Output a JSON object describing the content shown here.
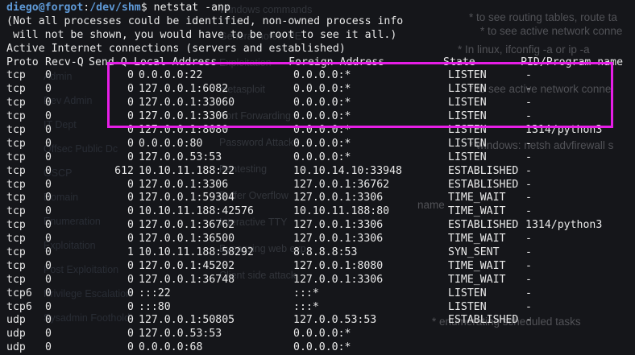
{
  "prompt": {
    "user_host": "diego@forgot",
    "sep": ":",
    "path": "/dev/shm",
    "symbol": "$",
    "command": " netstat -anp"
  },
  "notice": [
    "(Not all processes could be identified, non-owned process info",
    " will not be shown, you would have to be root to see it all.)",
    "Active Internet connections (servers and established)"
  ],
  "headers": [
    "Proto",
    "Recv-Q",
    "Send-Q",
    "Local Address",
    "Foreign Address",
    "State",
    "PID/Program name"
  ],
  "rows": [
    [
      "tcp",
      "0",
      "0",
      "0.0.0.0:22",
      "0.0.0.0:*",
      "LISTEN",
      "-"
    ],
    [
      "tcp",
      "0",
      "0",
      "127.0.0.1:6082",
      "0.0.0.0:*",
      "LISTEN",
      "-"
    ],
    [
      "tcp",
      "0",
      "0",
      "127.0.0.1:33060",
      "0.0.0.0:*",
      "LISTEN",
      "-"
    ],
    [
      "tcp",
      "0",
      "0",
      "127.0.0.1:3306",
      "0.0.0.0:*",
      "LISTEN",
      "-"
    ],
    [
      "tcp",
      "0",
      "0",
      "127.0.0.1:8080",
      "0.0.0.0:*",
      "LISTEN",
      "1314/python3"
    ],
    [
      "tcp",
      "0",
      "0",
      "0.0.0.0:80",
      "0.0.0.0:*",
      "LISTEN",
      "-"
    ],
    [
      "tcp",
      "0",
      "0",
      "127.0.0.53:53",
      "0.0.0.0:*",
      "LISTEN",
      "-"
    ],
    [
      "tcp",
      "0",
      "612",
      "10.10.11.188:22",
      "10.10.14.10:33948",
      "ESTABLISHED",
      "-"
    ],
    [
      "tcp",
      "0",
      "0",
      "127.0.0.1:3306",
      "127.0.0.1:36762",
      "ESTABLISHED",
      "-"
    ],
    [
      "tcp",
      "0",
      "0",
      "127.0.0.1:59304",
      "127.0.0.1:3306",
      "TIME_WAIT",
      "-"
    ],
    [
      "tcp",
      "0",
      "0",
      "10.10.11.188:42576",
      "10.10.11.188:80",
      "TIME_WAIT",
      "-"
    ],
    [
      "tcp",
      "0",
      "0",
      "127.0.0.1:36762",
      "127.0.0.1:3306",
      "ESTABLISHED",
      "1314/python3"
    ],
    [
      "tcp",
      "0",
      "0",
      "127.0.0.1:36500",
      "127.0.0.1:3306",
      "TIME_WAIT",
      "-"
    ],
    [
      "tcp",
      "0",
      "1",
      "10.10.11.188:58292",
      "8.8.8.8:53",
      "SYN_SENT",
      "-"
    ],
    [
      "tcp",
      "0",
      "0",
      "127.0.0.1:45202",
      "127.0.0.1:8080",
      "TIME_WAIT",
      "-"
    ],
    [
      "tcp",
      "0",
      "0",
      "127.0.0.1:36748",
      "127.0.0.1:3306",
      "TIME_WAIT",
      "-"
    ],
    [
      "tcp6",
      "0",
      "0",
      ":::22",
      ":::*",
      "LISTEN",
      "-"
    ],
    [
      "tcp6",
      "0",
      "0",
      ":::80",
      ":::*",
      "LISTEN",
      "-"
    ],
    [
      "udp",
      "0",
      "0",
      "127.0.0.1:50805",
      "127.0.0.53:53",
      "ESTABLISHED",
      "-"
    ],
    [
      "udp",
      "0",
      "0",
      "127.0.0.53:53",
      "0.0.0.0:*",
      "",
      ""
    ],
    [
      "udp",
      "0",
      "0",
      "0.0.0.0:68",
      "0.0.0.0:*",
      "",
      ""
    ]
  ],
  "highlight_color": "#e61ee6",
  "background_text": {
    "right": [
      "* to see routing tables, route ta",
      "* to see active network conne",
      "* In linux, ifconfig -a or ip -a",
      "* to see active network conne",
      "* windows: netsh advfirewall s",
      "name",
      "* enumerating scheduled tasks"
    ],
    "side": [
      "Admin",
      "Dev Admin",
      "IT Dept",
      "Offsec Public Dc",
      "OSCP",
      "Domain",
      "Enumeration",
      "Exploitation",
      "Post Exploitation",
      "Privilege Escalation",
      "Sysadmin Foothold"
    ],
    "middle": [
      "Windows commands",
      "General notes: PE",
      "Exploitation",
      "metasploit",
      "Port Forwarding",
      "Password Attacks",
      "Pentesting",
      "Buffer Overflow",
      "Interactive TTY",
      "Bypassing web exp",
      "Client side attack"
    ]
  }
}
